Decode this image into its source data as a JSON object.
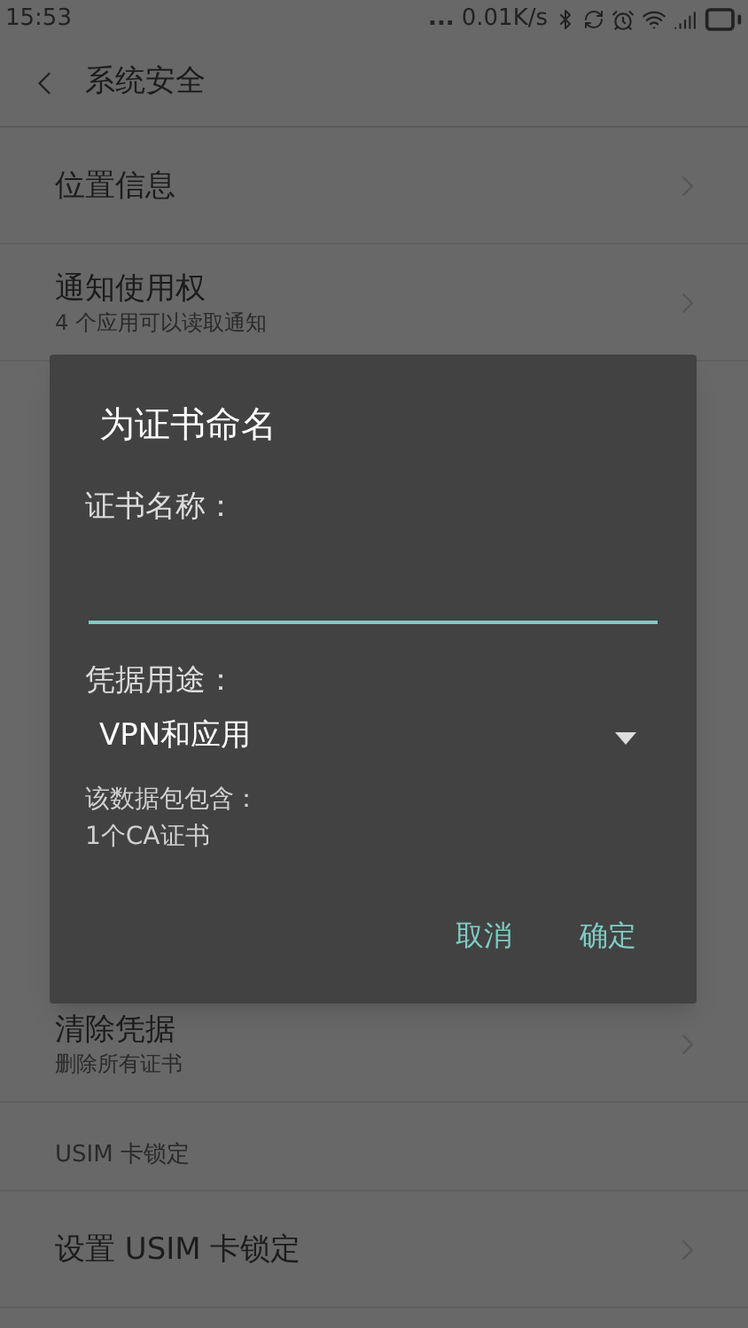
{
  "status_bar": {
    "time": "15:53",
    "more": "...",
    "speed": "0.01K/s"
  },
  "header": {
    "title": "系统安全"
  },
  "top_items": [
    {
      "title": "位置信息"
    },
    {
      "title": "通知使用权",
      "subtitle": "4 个应用可以读取通知"
    }
  ],
  "bottom_items": [
    {
      "kind": "item",
      "title": "清除凭据",
      "subtitle": "删除所有证书"
    },
    {
      "kind": "section",
      "title": "USIM 卡锁定"
    },
    {
      "kind": "item",
      "title": "设置 USIM 卡锁定"
    }
  ],
  "dialog": {
    "title": "为证书命名",
    "name_label": "证书名称：",
    "usage_label": "凭据用途：",
    "usage_value": "VPN和应用",
    "info_label": "该数据包包含：",
    "info_value": "1个CA证书",
    "buttons": [
      "取消",
      "确定"
    ]
  }
}
